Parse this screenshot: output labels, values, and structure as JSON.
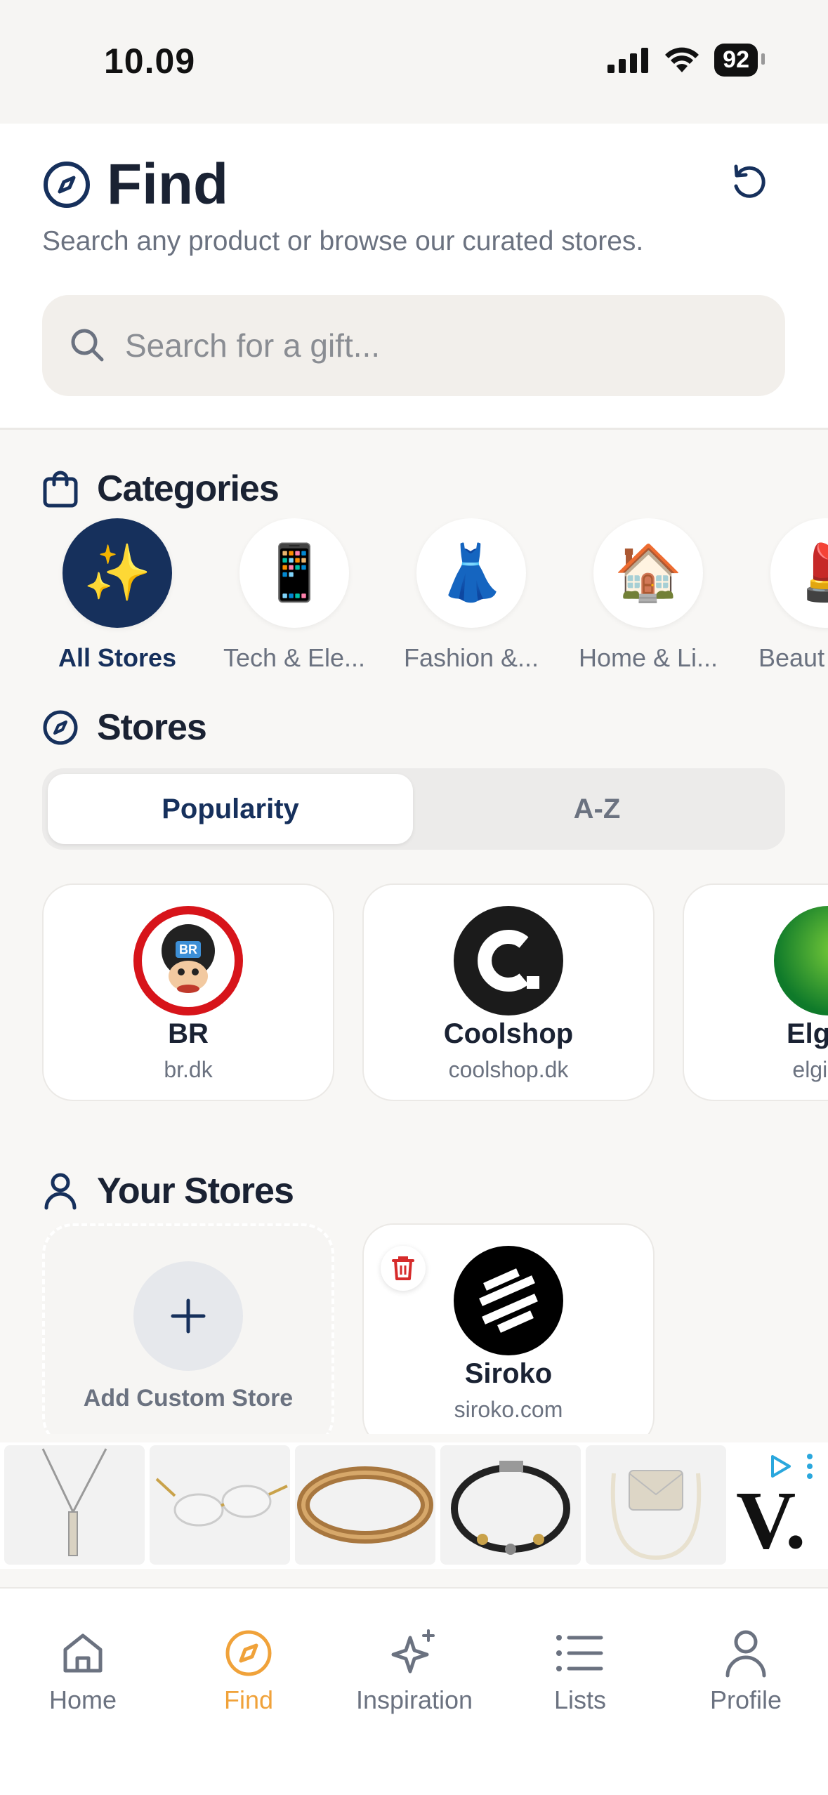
{
  "status_bar": {
    "time": "10.09",
    "battery": "92"
  },
  "header": {
    "title": "Find",
    "subtitle": "Search any product or browse our curated stores.",
    "search_placeholder": "Search for a gift..."
  },
  "categories": {
    "title": "Categories",
    "items": [
      {
        "label": "All Stores",
        "icon": "✨",
        "active": true
      },
      {
        "label": "Tech & Ele...",
        "icon": "📱",
        "active": false
      },
      {
        "label": "Fashion &...",
        "icon": "👗",
        "active": false
      },
      {
        "label": "Home & Li...",
        "icon": "🏠",
        "active": false
      },
      {
        "label": "Beaut",
        "icon": "💄",
        "active": false
      }
    ]
  },
  "stores": {
    "title": "Stores",
    "sort_tabs": [
      "Popularity",
      "A-Z"
    ],
    "active_sort": "Popularity",
    "items": [
      {
        "name": "BR",
        "domain": "br.dk"
      },
      {
        "name": "Coolshop",
        "domain": "coolshop.dk"
      },
      {
        "name": "Elgiga",
        "domain": "elgigan"
      }
    ]
  },
  "your_stores": {
    "title": "Your Stores",
    "add_label": "Add Custom Store",
    "items": [
      {
        "name": "Siroko",
        "domain": "siroko.com"
      }
    ]
  },
  "ad": {
    "logo_text": "V."
  },
  "tabbar": {
    "items": [
      {
        "label": "Home",
        "icon": "home-icon",
        "active": false
      },
      {
        "label": "Find",
        "icon": "compass-icon",
        "active": true
      },
      {
        "label": "Inspiration",
        "icon": "sparkles-icon",
        "active": false
      },
      {
        "label": "Lists",
        "icon": "list-icon",
        "active": false
      },
      {
        "label": "Profile",
        "icon": "user-icon",
        "active": false
      }
    ]
  },
  "colors": {
    "navy": "#16305c",
    "accent": "#f0a23a",
    "delete_red": "#d62b2b"
  }
}
